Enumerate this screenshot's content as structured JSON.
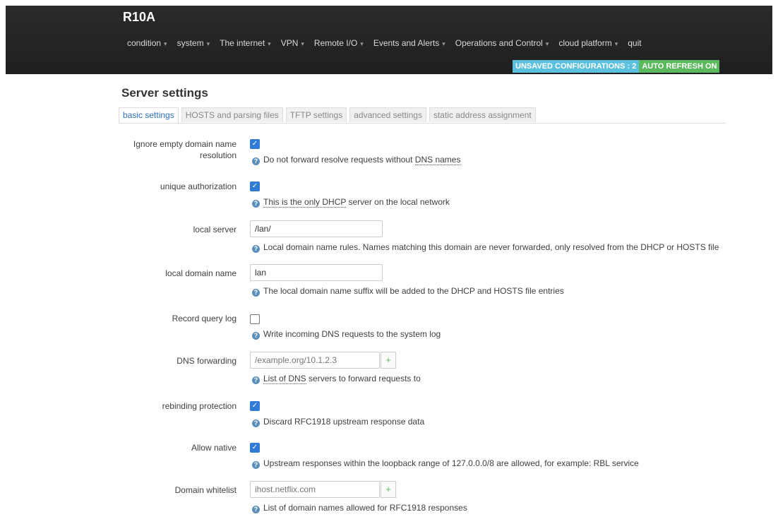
{
  "app": {
    "title": "R10A"
  },
  "nav": [
    {
      "label": "condition"
    },
    {
      "label": "system"
    },
    {
      "label": "The internet"
    },
    {
      "label": "VPN"
    },
    {
      "label": "Remote I/O"
    },
    {
      "label": "Events and Alerts"
    },
    {
      "label": "Operations and Control"
    },
    {
      "label": "cloud platform"
    },
    {
      "label": "quit"
    }
  ],
  "caret": "▾",
  "badges": {
    "unsaved": "UNSAVED CONFIGURATIONS : 2",
    "refresh": "AUTO REFRESH ON"
  },
  "section": {
    "title": "Server settings"
  },
  "tabs": [
    {
      "label": "basic settings",
      "active": true
    },
    {
      "label": "HOSTS and parsing files"
    },
    {
      "label": "TFTP settings"
    },
    {
      "label": "advanced settings"
    },
    {
      "label": "static address assignment"
    }
  ],
  "fields": {
    "ignore_empty": {
      "label_line1": "Ignore empty domain name",
      "label_line2": "resolution",
      "checked": true,
      "help_pre": "Do not forward resolve requests without ",
      "help_abbr": "DNS names"
    },
    "unique_auth": {
      "label": "unique authorization",
      "checked": true,
      "help_abbr": "This is the only DHCP",
      "help_post": " server on the local network"
    },
    "local_server": {
      "label": "local server",
      "value": "/lan/",
      "help": "Local domain name rules. Names matching this domain are never forwarded, only resolved from the DHCP or HOSTS file"
    },
    "local_domain": {
      "label": "local domain name",
      "value": "lan",
      "help": "The local domain name suffix will be added to the DHCP and HOSTS file entries"
    },
    "query_log": {
      "label": "Record query log",
      "checked": false,
      "help": "Write incoming DNS requests to the system log"
    },
    "dns_forwarding": {
      "label": "DNS forwarding",
      "placeholder": "/example.org/10.1.2.3",
      "add": "+",
      "help_abbr": "List of DNS",
      "help_post": " servers to forward requests to"
    },
    "rebind": {
      "label": "rebinding protection",
      "checked": true,
      "help": "Discard RFC1918 upstream response data"
    },
    "allow_native": {
      "label": "Allow native",
      "checked": true,
      "help": "Upstream responses within the loopback range of 127.0.0.0/8 are allowed, for example: RBL service"
    },
    "domain_whitelist": {
      "label": "Domain whitelist",
      "placeholder": "ihost.netflix.com",
      "add": "+",
      "help": "List of domain names allowed for RFC1918 responses"
    }
  },
  "icons": {
    "help": "?",
    "check": "✓"
  },
  "colors": {
    "header": "#222222",
    "accent": "#2f7bd5",
    "badge_unsaved": "#5bc0de",
    "badge_refresh": "#5cb85c"
  }
}
